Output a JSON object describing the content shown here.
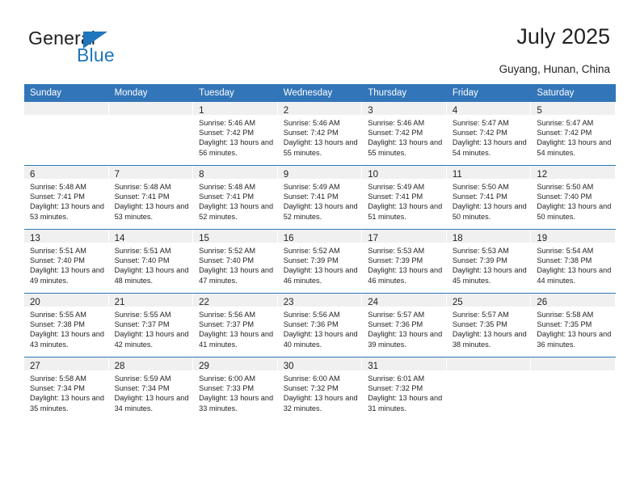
{
  "brand": {
    "name_part1": "General",
    "name_part2": "Blue",
    "triangle_icon": "triangle-icon",
    "color_dark": "#231f20",
    "color_blue": "#1f76bc"
  },
  "header": {
    "title": "July 2025",
    "location": "Guyang, Hunan, China"
  },
  "theme": {
    "header_blue": "#3275b8",
    "daynum_band": "#f0f0f0",
    "text": "#231f20"
  },
  "weekdays": [
    "Sunday",
    "Monday",
    "Tuesday",
    "Wednesday",
    "Thursday",
    "Friday",
    "Saturday"
  ],
  "labels": {
    "sunrise_prefix": "Sunrise:",
    "sunset_prefix": "Sunset:",
    "daylight_prefix": "Daylight:"
  },
  "chart_data": {
    "type": "table",
    "title": "July 2025 — Guyang, Hunan, China sunrise/sunset calendar",
    "columns": [
      "Sunday",
      "Monday",
      "Tuesday",
      "Wednesday",
      "Thursday",
      "Friday",
      "Saturday"
    ],
    "rows": [
      [
        null,
        null,
        1,
        2,
        3,
        4,
        5
      ],
      [
        6,
        7,
        8,
        9,
        10,
        11,
        12
      ],
      [
        13,
        14,
        15,
        16,
        17,
        18,
        19
      ],
      [
        20,
        21,
        22,
        23,
        24,
        25,
        26
      ],
      [
        27,
        28,
        29,
        30,
        31,
        null,
        null
      ]
    ],
    "days": {
      "1": {
        "sunrise": "5:46 AM",
        "sunset": "7:42 PM",
        "daylight_hours": 13,
        "daylight_minutes": 56
      },
      "2": {
        "sunrise": "5:46 AM",
        "sunset": "7:42 PM",
        "daylight_hours": 13,
        "daylight_minutes": 55
      },
      "3": {
        "sunrise": "5:46 AM",
        "sunset": "7:42 PM",
        "daylight_hours": 13,
        "daylight_minutes": 55
      },
      "4": {
        "sunrise": "5:47 AM",
        "sunset": "7:42 PM",
        "daylight_hours": 13,
        "daylight_minutes": 54
      },
      "5": {
        "sunrise": "5:47 AM",
        "sunset": "7:42 PM",
        "daylight_hours": 13,
        "daylight_minutes": 54
      },
      "6": {
        "sunrise": "5:48 AM",
        "sunset": "7:41 PM",
        "daylight_hours": 13,
        "daylight_minutes": 53
      },
      "7": {
        "sunrise": "5:48 AM",
        "sunset": "7:41 PM",
        "daylight_hours": 13,
        "daylight_minutes": 53
      },
      "8": {
        "sunrise": "5:48 AM",
        "sunset": "7:41 PM",
        "daylight_hours": 13,
        "daylight_minutes": 52
      },
      "9": {
        "sunrise": "5:49 AM",
        "sunset": "7:41 PM",
        "daylight_hours": 13,
        "daylight_minutes": 52
      },
      "10": {
        "sunrise": "5:49 AM",
        "sunset": "7:41 PM",
        "daylight_hours": 13,
        "daylight_minutes": 51
      },
      "11": {
        "sunrise": "5:50 AM",
        "sunset": "7:41 PM",
        "daylight_hours": 13,
        "daylight_minutes": 50
      },
      "12": {
        "sunrise": "5:50 AM",
        "sunset": "7:40 PM",
        "daylight_hours": 13,
        "daylight_minutes": 50
      },
      "13": {
        "sunrise": "5:51 AM",
        "sunset": "7:40 PM",
        "daylight_hours": 13,
        "daylight_minutes": 49
      },
      "14": {
        "sunrise": "5:51 AM",
        "sunset": "7:40 PM",
        "daylight_hours": 13,
        "daylight_minutes": 48
      },
      "15": {
        "sunrise": "5:52 AM",
        "sunset": "7:40 PM",
        "daylight_hours": 13,
        "daylight_minutes": 47
      },
      "16": {
        "sunrise": "5:52 AM",
        "sunset": "7:39 PM",
        "daylight_hours": 13,
        "daylight_minutes": 46
      },
      "17": {
        "sunrise": "5:53 AM",
        "sunset": "7:39 PM",
        "daylight_hours": 13,
        "daylight_minutes": 46
      },
      "18": {
        "sunrise": "5:53 AM",
        "sunset": "7:39 PM",
        "daylight_hours": 13,
        "daylight_minutes": 45
      },
      "19": {
        "sunrise": "5:54 AM",
        "sunset": "7:38 PM",
        "daylight_hours": 13,
        "daylight_minutes": 44
      },
      "20": {
        "sunrise": "5:55 AM",
        "sunset": "7:38 PM",
        "daylight_hours": 13,
        "daylight_minutes": 43
      },
      "21": {
        "sunrise": "5:55 AM",
        "sunset": "7:37 PM",
        "daylight_hours": 13,
        "daylight_minutes": 42
      },
      "22": {
        "sunrise": "5:56 AM",
        "sunset": "7:37 PM",
        "daylight_hours": 13,
        "daylight_minutes": 41
      },
      "23": {
        "sunrise": "5:56 AM",
        "sunset": "7:36 PM",
        "daylight_hours": 13,
        "daylight_minutes": 40
      },
      "24": {
        "sunrise": "5:57 AM",
        "sunset": "7:36 PM",
        "daylight_hours": 13,
        "daylight_minutes": 39
      },
      "25": {
        "sunrise": "5:57 AM",
        "sunset": "7:35 PM",
        "daylight_hours": 13,
        "daylight_minutes": 38
      },
      "26": {
        "sunrise": "5:58 AM",
        "sunset": "7:35 PM",
        "daylight_hours": 13,
        "daylight_minutes": 36
      },
      "27": {
        "sunrise": "5:58 AM",
        "sunset": "7:34 PM",
        "daylight_hours": 13,
        "daylight_minutes": 35
      },
      "28": {
        "sunrise": "5:59 AM",
        "sunset": "7:34 PM",
        "daylight_hours": 13,
        "daylight_minutes": 34
      },
      "29": {
        "sunrise": "6:00 AM",
        "sunset": "7:33 PM",
        "daylight_hours": 13,
        "daylight_minutes": 33
      },
      "30": {
        "sunrise": "6:00 AM",
        "sunset": "7:32 PM",
        "daylight_hours": 13,
        "daylight_minutes": 32
      },
      "31": {
        "sunrise": "6:01 AM",
        "sunset": "7:32 PM",
        "daylight_hours": 13,
        "daylight_minutes": 31
      }
    }
  }
}
